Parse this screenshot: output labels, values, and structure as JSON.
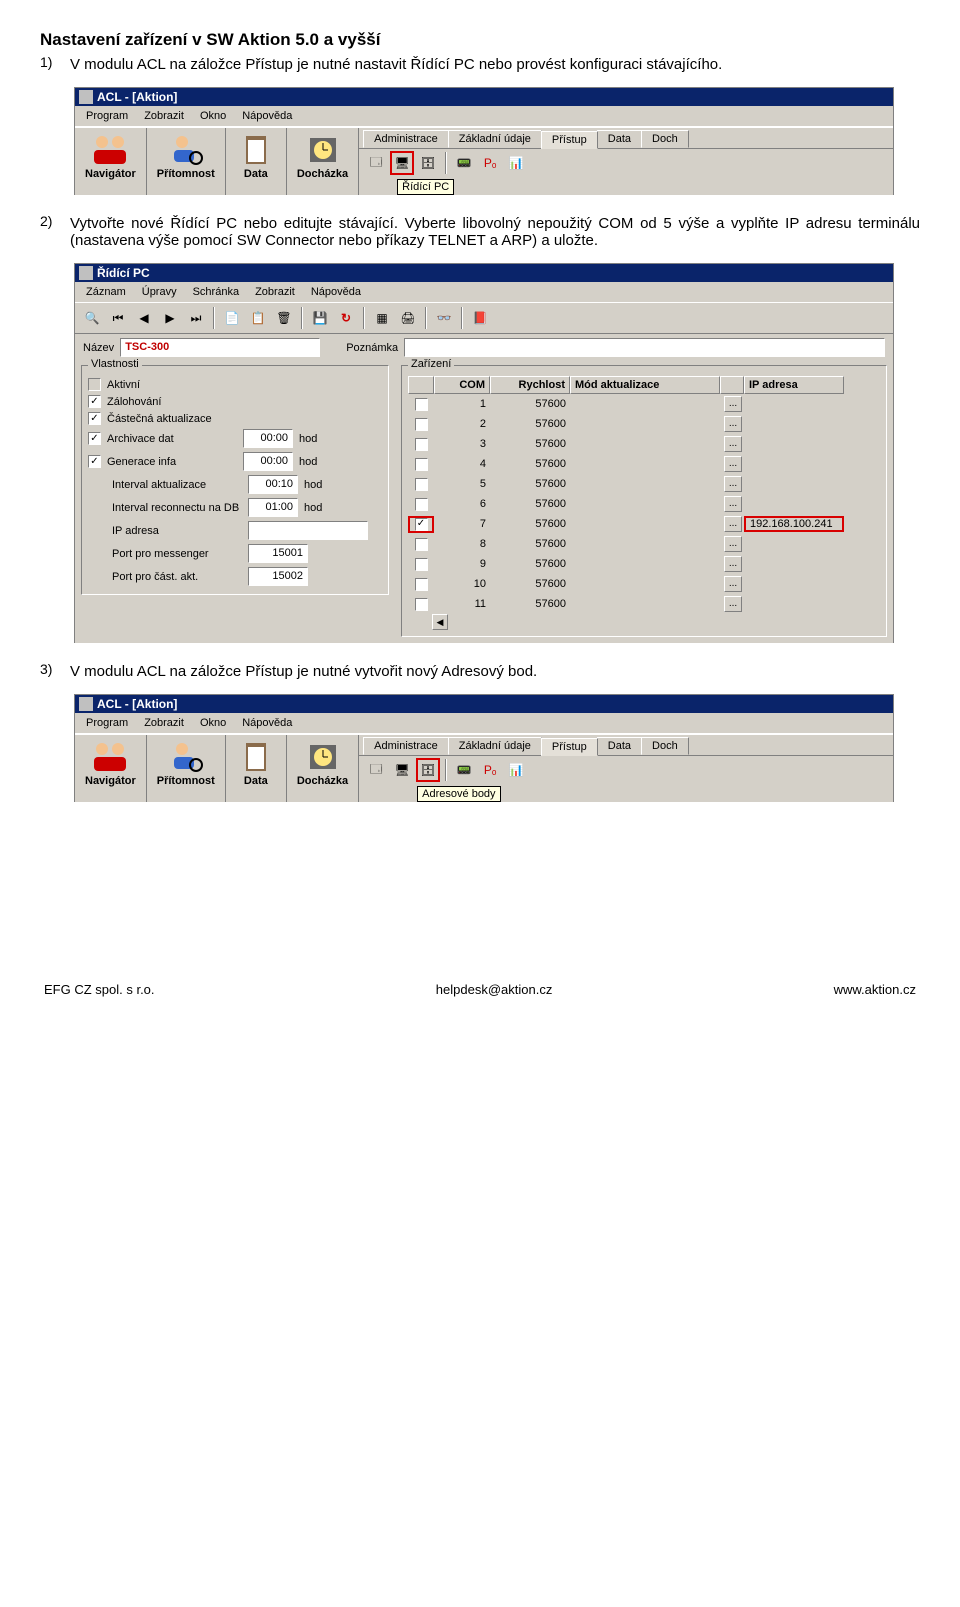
{
  "doc": {
    "title": "Nastavení zařízení v SW Aktion 5.0 a vyšší",
    "step1_num": "1)",
    "step1_text": "V modulu ACL na záložce Přístup je nutné nastavit Řídící PC nebo provést konfiguraci stávajícího.",
    "step2_num": "2)",
    "step2_text": "Vytvořte nové Řídící PC nebo editujte stávající. Vyberte libovolný nepoužitý COM od 5 výše a vyplňte IP adresu terminálu (nastavena výše pomocí SW Connector nebo příkazy TELNET a ARP) a uložte.",
    "step3_num": "3)",
    "step3_text": "V modulu ACL na záložce Přístup je nutné vytvořit nový Adresový bod."
  },
  "acl": {
    "title": "ACL - [Aktion]",
    "menu": {
      "program": "Program",
      "zobrazit": "Zobrazit",
      "okno": "Okno",
      "napoveda": "Nápověda"
    },
    "bigbtns": {
      "navigator": "Navigátor",
      "pritomnost": "Přítomnost",
      "data": "Data",
      "dochazka": "Docházka"
    },
    "tabs": {
      "admin": "Administrace",
      "zakl": "Základní údaje",
      "pristup": "Přístup",
      "data": "Data",
      "doch": "Doch"
    },
    "tooltip1": "Řídící PC",
    "tooltip2": "Adresové body"
  },
  "dlg": {
    "title": "Řídící PC",
    "menu": {
      "zaznam": "Záznam",
      "upravy": "Úpravy",
      "schranka": "Schránka",
      "zobrazit": "Zobrazit",
      "napoveda": "Nápověda"
    },
    "lblNazev": "Název",
    "valNazev": "TSC-300",
    "lblPoznamka": "Poznámka",
    "grpVlast": "Vlastnosti",
    "chkAktivni": "Aktivní",
    "chkZaloh": "Zálohování",
    "chkCast": "Částečná aktualizace",
    "lblArch": "Archivace dat",
    "lblGen": "Generace infa",
    "lblIntA": "Interval aktualizace",
    "lblIntR": "Interval reconnectu na DB",
    "lblIP": "IP adresa",
    "lblPortM": "Port pro messenger",
    "lblPortC": "Port pro část. akt.",
    "valArch": "00:00",
    "valGen": "00:00",
    "valIntA": "00:10",
    "valIntR": "01:00",
    "valPortM": "15001",
    "valPortC": "15002",
    "hod": "hod",
    "grpZar": "Zařízení",
    "hdrCom": "COM",
    "hdrRych": "Rychlost",
    "hdrMod": "Mód aktualizace",
    "hdrIP": "IP adresa",
    "ip7": "192.168.100.241",
    "rows": [
      {
        "com": "1",
        "rych": "57600"
      },
      {
        "com": "2",
        "rych": "57600"
      },
      {
        "com": "3",
        "rych": "57600"
      },
      {
        "com": "4",
        "rych": "57600"
      },
      {
        "com": "5",
        "rych": "57600"
      },
      {
        "com": "6",
        "rych": "57600"
      },
      {
        "com": "7",
        "rych": "57600"
      },
      {
        "com": "8",
        "rych": "57600"
      },
      {
        "com": "9",
        "rych": "57600"
      },
      {
        "com": "10",
        "rych": "57600"
      },
      {
        "com": "11",
        "rych": "57600"
      }
    ]
  },
  "footer": {
    "left": "EFG CZ spol. s r.o.",
    "mid": "helpdesk@aktion.cz",
    "right": "www.aktion.cz"
  }
}
